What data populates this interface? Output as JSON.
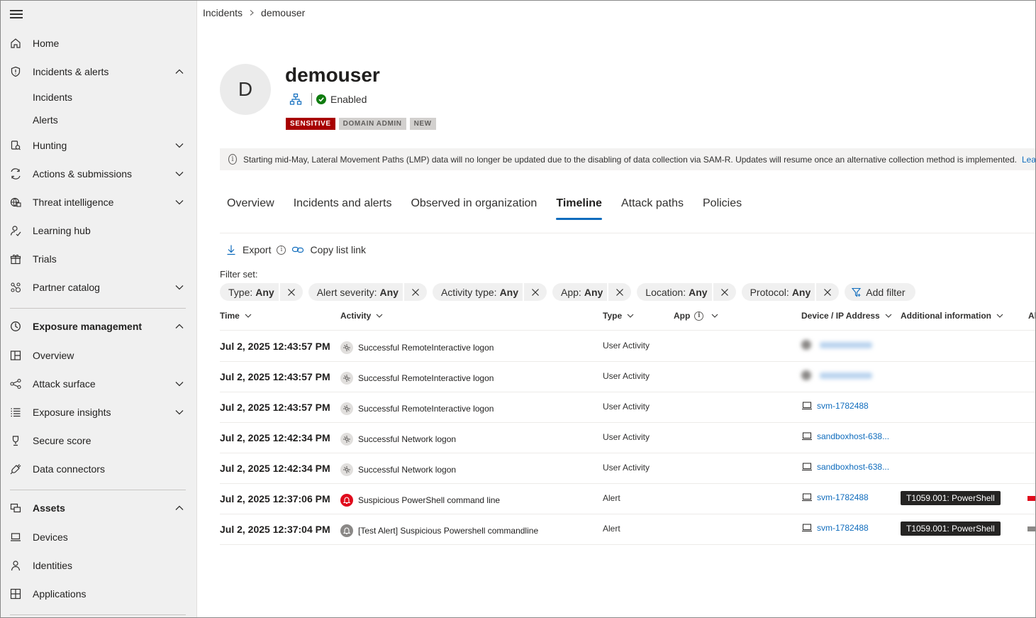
{
  "breadcrumb": {
    "parent": "Incidents",
    "current": "demouser"
  },
  "sidebar": {
    "items": [
      {
        "label": "Home",
        "icon": "home-icon"
      },
      {
        "label": "Incidents & alerts",
        "icon": "shield-icon"
      },
      {
        "label": "Incidents"
      },
      {
        "label": "Alerts"
      },
      {
        "label": "Hunting",
        "icon": "hunting-icon"
      },
      {
        "label": "Actions & submissions",
        "icon": "actions-icon"
      },
      {
        "label": "Threat intelligence",
        "icon": "threat-intel-icon"
      },
      {
        "label": "Learning hub",
        "icon": "learning-icon"
      },
      {
        "label": "Trials",
        "icon": "trials-icon"
      },
      {
        "label": "Partner catalog",
        "icon": "partner-icon"
      },
      {
        "label": "Exposure management",
        "icon": "exposure-icon"
      },
      {
        "label": "Overview",
        "icon": "overview-icon"
      },
      {
        "label": "Attack surface",
        "icon": "attack-surface-icon"
      },
      {
        "label": "Exposure insights",
        "icon": "insights-icon"
      },
      {
        "label": "Secure score",
        "icon": "trophy-icon"
      },
      {
        "label": "Data connectors",
        "icon": "connector-icon"
      },
      {
        "label": "Assets",
        "icon": "assets-icon"
      },
      {
        "label": "Devices",
        "icon": "device-icon"
      },
      {
        "label": "Identities",
        "icon": "person-icon"
      },
      {
        "label": "Applications",
        "icon": "apps-icon"
      }
    ]
  },
  "user": {
    "initial": "D",
    "name": "demouser",
    "status": "Enabled",
    "tags": [
      "SENSITIVE",
      "DOMAIN ADMIN",
      "NEW"
    ]
  },
  "banner": {
    "text": "Starting mid-May, Lateral Movement Paths (LMP) data will no longer be updated due to the disabling of data collection via SAM-R. Updates will resume once an alternative collection method is implemented.",
    "link": "Lea"
  },
  "tabs": [
    "Overview",
    "Incidents and alerts",
    "Observed in organization",
    "Timeline",
    "Attack paths",
    "Policies"
  ],
  "active_tab": "Timeline",
  "toolbar": {
    "export": "Export",
    "copy_link": "Copy list link"
  },
  "filter_set_label": "Filter set:",
  "filters": [
    {
      "name": "Type:",
      "value": "Any"
    },
    {
      "name": "Alert severity:",
      "value": "Any"
    },
    {
      "name": "Activity type:",
      "value": "Any"
    },
    {
      "name": "App:",
      "value": "Any"
    },
    {
      "name": "Location:",
      "value": "Any"
    },
    {
      "name": "Protocol:",
      "value": "Any"
    }
  ],
  "add_filter": "Add filter",
  "columns": {
    "time": "Time",
    "activity": "Activity",
    "type": "Type",
    "app": "App",
    "device": "Device / IP Address",
    "info": "Additional information",
    "extra": "Al"
  },
  "rows": [
    {
      "time": "Jul 2, 2025 12:43:57 PM",
      "activity": "Successful RemoteInteractive logon",
      "type": "User Activity",
      "device": "",
      "info": "",
      "severity_color": ""
    },
    {
      "time": "Jul 2, 2025 12:43:57 PM",
      "activity": "Successful RemoteInteractive logon",
      "type": "User Activity",
      "device": "",
      "info": "",
      "severity_color": ""
    },
    {
      "time": "Jul 2, 2025 12:43:57 PM",
      "activity": "Successful RemoteInteractive logon",
      "type": "User Activity",
      "device": "svm-1782488",
      "info": "",
      "severity_color": ""
    },
    {
      "time": "Jul 2, 2025 12:42:34 PM",
      "activity": "Successful Network logon",
      "type": "User Activity",
      "device": "sandboxhost-638...",
      "info": "",
      "severity_color": ""
    },
    {
      "time": "Jul 2, 2025 12:42:34 PM",
      "activity": "Successful Network logon",
      "type": "User Activity",
      "device": "sandboxhost-638...",
      "info": "",
      "severity_color": ""
    },
    {
      "time": "Jul 2, 2025 12:37:06 PM",
      "activity": "Suspicious PowerShell command line",
      "type": "Alert",
      "device": "svm-1782488",
      "info": "T1059.001: PowerShell",
      "severity_color": "#e00b1c"
    },
    {
      "time": "Jul 2, 2025 12:37:04 PM",
      "activity": "[Test Alert] Suspicious Powershell commandline",
      "type": "Alert",
      "device": "svm-1782488",
      "info": "T1059.001: PowerShell",
      "severity_color": "#8a8886"
    }
  ],
  "colors": {
    "accent": "#0f6cbd",
    "sensitive": "#a80000",
    "alert_red": "#e00b1c",
    "enabled_green": "#107c10"
  }
}
